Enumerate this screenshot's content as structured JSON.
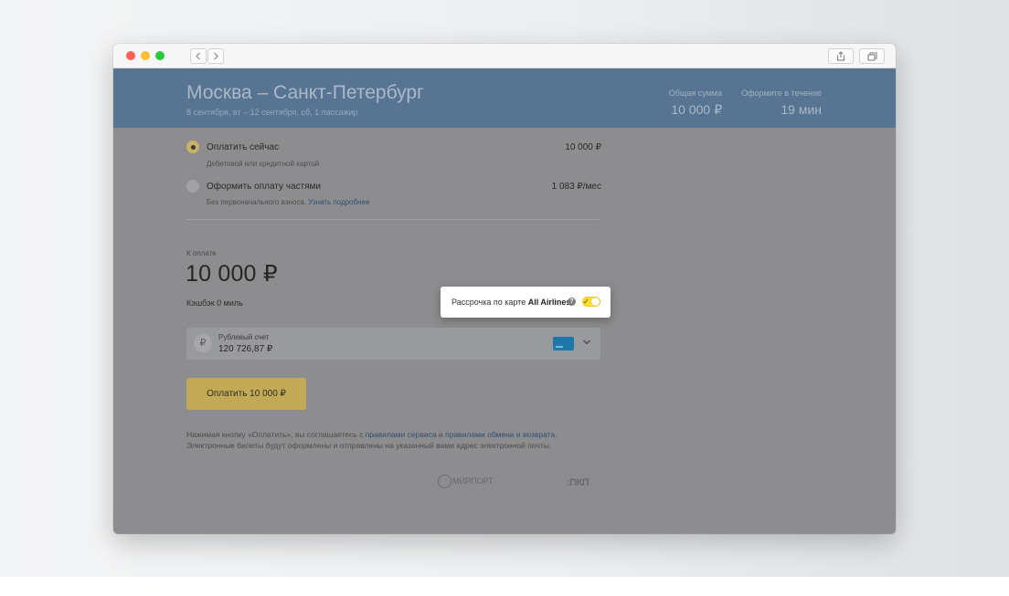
{
  "header": {
    "route_title": "Москва – Санкт-Петербург",
    "route_details": "8 сентября, вт – 12 сентября, сб, 1 пассажир",
    "total_label": "Общая сумма",
    "total_value": "10 000 ₽",
    "time_label": "Оформите в течение",
    "time_value": "19 мин"
  },
  "payment_options": [
    {
      "title": "Оплатить сейчас",
      "subtitle": "Дебетовой или кредитной картой",
      "amount": "10 000 ₽",
      "selected": true
    },
    {
      "title": "Оформить оплату частями",
      "subtitle": "Без первоначального взноса.",
      "link": "Узнать подробнее",
      "amount": "1 083 ₽/мес",
      "selected": false
    }
  ],
  "summary": {
    "pay_label": "К оплате",
    "pay_amount": "10 000 ₽",
    "cashback": "Кэшбэк 0 миль"
  },
  "installment_popover": {
    "text": "Рассрочка по карте",
    "brand": "All Airlines",
    "toggle_on": true
  },
  "account": {
    "currency_symbol": "₽",
    "name": "Рублевый счет",
    "balance": "120 726,87 ₽"
  },
  "pay_button": "Оплатить 10 000 ₽",
  "terms": {
    "prefix": "Нажимая кнопку «Оплатить», вы соглашаетесь с",
    "link_rules": "правилами сервиса",
    "and": "и",
    "link_exchange": "правилами обмена и возврата",
    "line2": "Электронные билеты будут оформлены и отправлены на указанный вами адрес электронной почты."
  },
  "footer_logos": {
    "mir": "МИРПОРТ",
    "nkp": "ПКП"
  },
  "colors": {
    "header_bg": "#577593",
    "accent_yellow": "#ffdd2d",
    "link": "#2d4f77"
  }
}
